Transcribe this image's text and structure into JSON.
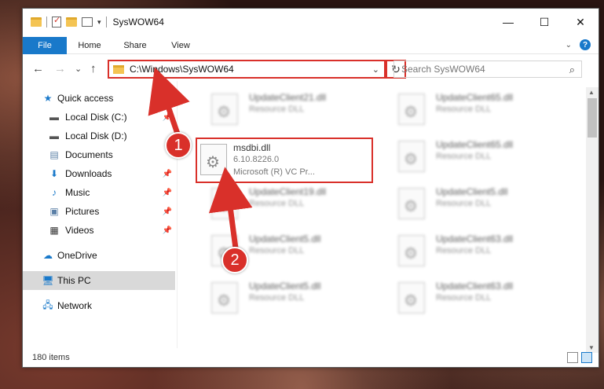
{
  "window": {
    "title": "SysWOW64",
    "controls": {
      "minimize": "—",
      "maximize": "☐",
      "close": "✕"
    }
  },
  "ribbon": {
    "tabs": [
      "File",
      "Home",
      "Share",
      "View"
    ],
    "help": "?"
  },
  "navigation": {
    "back": "←",
    "forward": "→",
    "recent": "⌄",
    "up": "↑",
    "address": "C:\\Windows\\SysWOW64",
    "refresh": "↻"
  },
  "search": {
    "placeholder": "Search SysWOW64",
    "icon": "search-icon"
  },
  "sidebar": {
    "items": [
      {
        "label": "Quick access",
        "icon": "star-icon"
      },
      {
        "label": "Local Disk (C:)",
        "icon": "drive-icon"
      },
      {
        "label": "Local Disk (D:)",
        "icon": "drive-icon"
      },
      {
        "label": "Documents",
        "icon": "documents-icon"
      },
      {
        "label": "Downloads",
        "icon": "download-icon"
      },
      {
        "label": "Music",
        "icon": "music-icon"
      },
      {
        "label": "Pictures",
        "icon": "pictures-icon"
      },
      {
        "label": "Videos",
        "icon": "videos-icon"
      },
      {
        "label": "OneDrive",
        "icon": "cloud-icon"
      },
      {
        "label": "This PC",
        "icon": "computer-icon"
      },
      {
        "label": "Network",
        "icon": "network-icon"
      }
    ]
  },
  "files": {
    "col1": [
      {
        "name": "UpdateClient21.dll",
        "type": "Resource DLL"
      },
      {
        "name": "msdbi.dll",
        "type": "6.10.8226.0",
        "desc": "Microsoft (R) VC Pr..."
      },
      {
        "name": "UpdateClient19.dll",
        "type": "Resource DLL"
      },
      {
        "name": "UpdateClient5.dll",
        "type": "Resource DLL"
      },
      {
        "name": "UpdateClient5.dll",
        "type": "Resource DLL"
      }
    ],
    "col2": [
      {
        "name": "UpdateClient65.dll",
        "type": "Resource DLL"
      },
      {
        "name": "UpdateClient65.dll",
        "type": "Resource DLL"
      },
      {
        "name": "UpdateClient5.dll",
        "type": "Resource DLL"
      },
      {
        "name": "UpdateClient63.dll",
        "type": "Resource DLL"
      },
      {
        "name": "UpdateClient63.dll",
        "type": "Resource DLL"
      }
    ]
  },
  "status": {
    "items_count": "180 items"
  },
  "annotations": {
    "step1": "1",
    "step2": "2",
    "color": "#d9302a"
  }
}
